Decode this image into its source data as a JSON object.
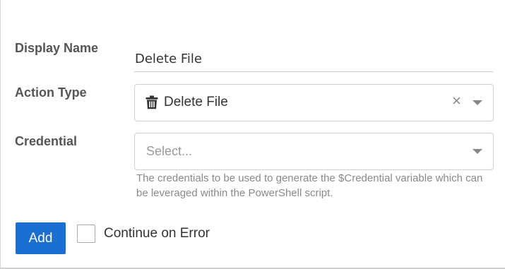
{
  "form": {
    "display_name": {
      "label": "Display Name",
      "value": "Delete File"
    },
    "action_type": {
      "label": "Action Type",
      "selected": "Delete File",
      "icon": "trash-icon",
      "clear_glyph": "×"
    },
    "credential": {
      "label": "Credential",
      "placeholder": "Select...",
      "help": "The credentials to be used to generate the $Credential variable which can be leveraged within the PowerShell script."
    }
  },
  "actions": {
    "add_label": "Add",
    "continue_on_error_label": "Continue on Error",
    "continue_on_error_checked": false
  },
  "colors": {
    "primary": "#1b6fd1",
    "label": "#555555",
    "help_text": "#8a8a8a",
    "border": "#cfcfcf"
  }
}
